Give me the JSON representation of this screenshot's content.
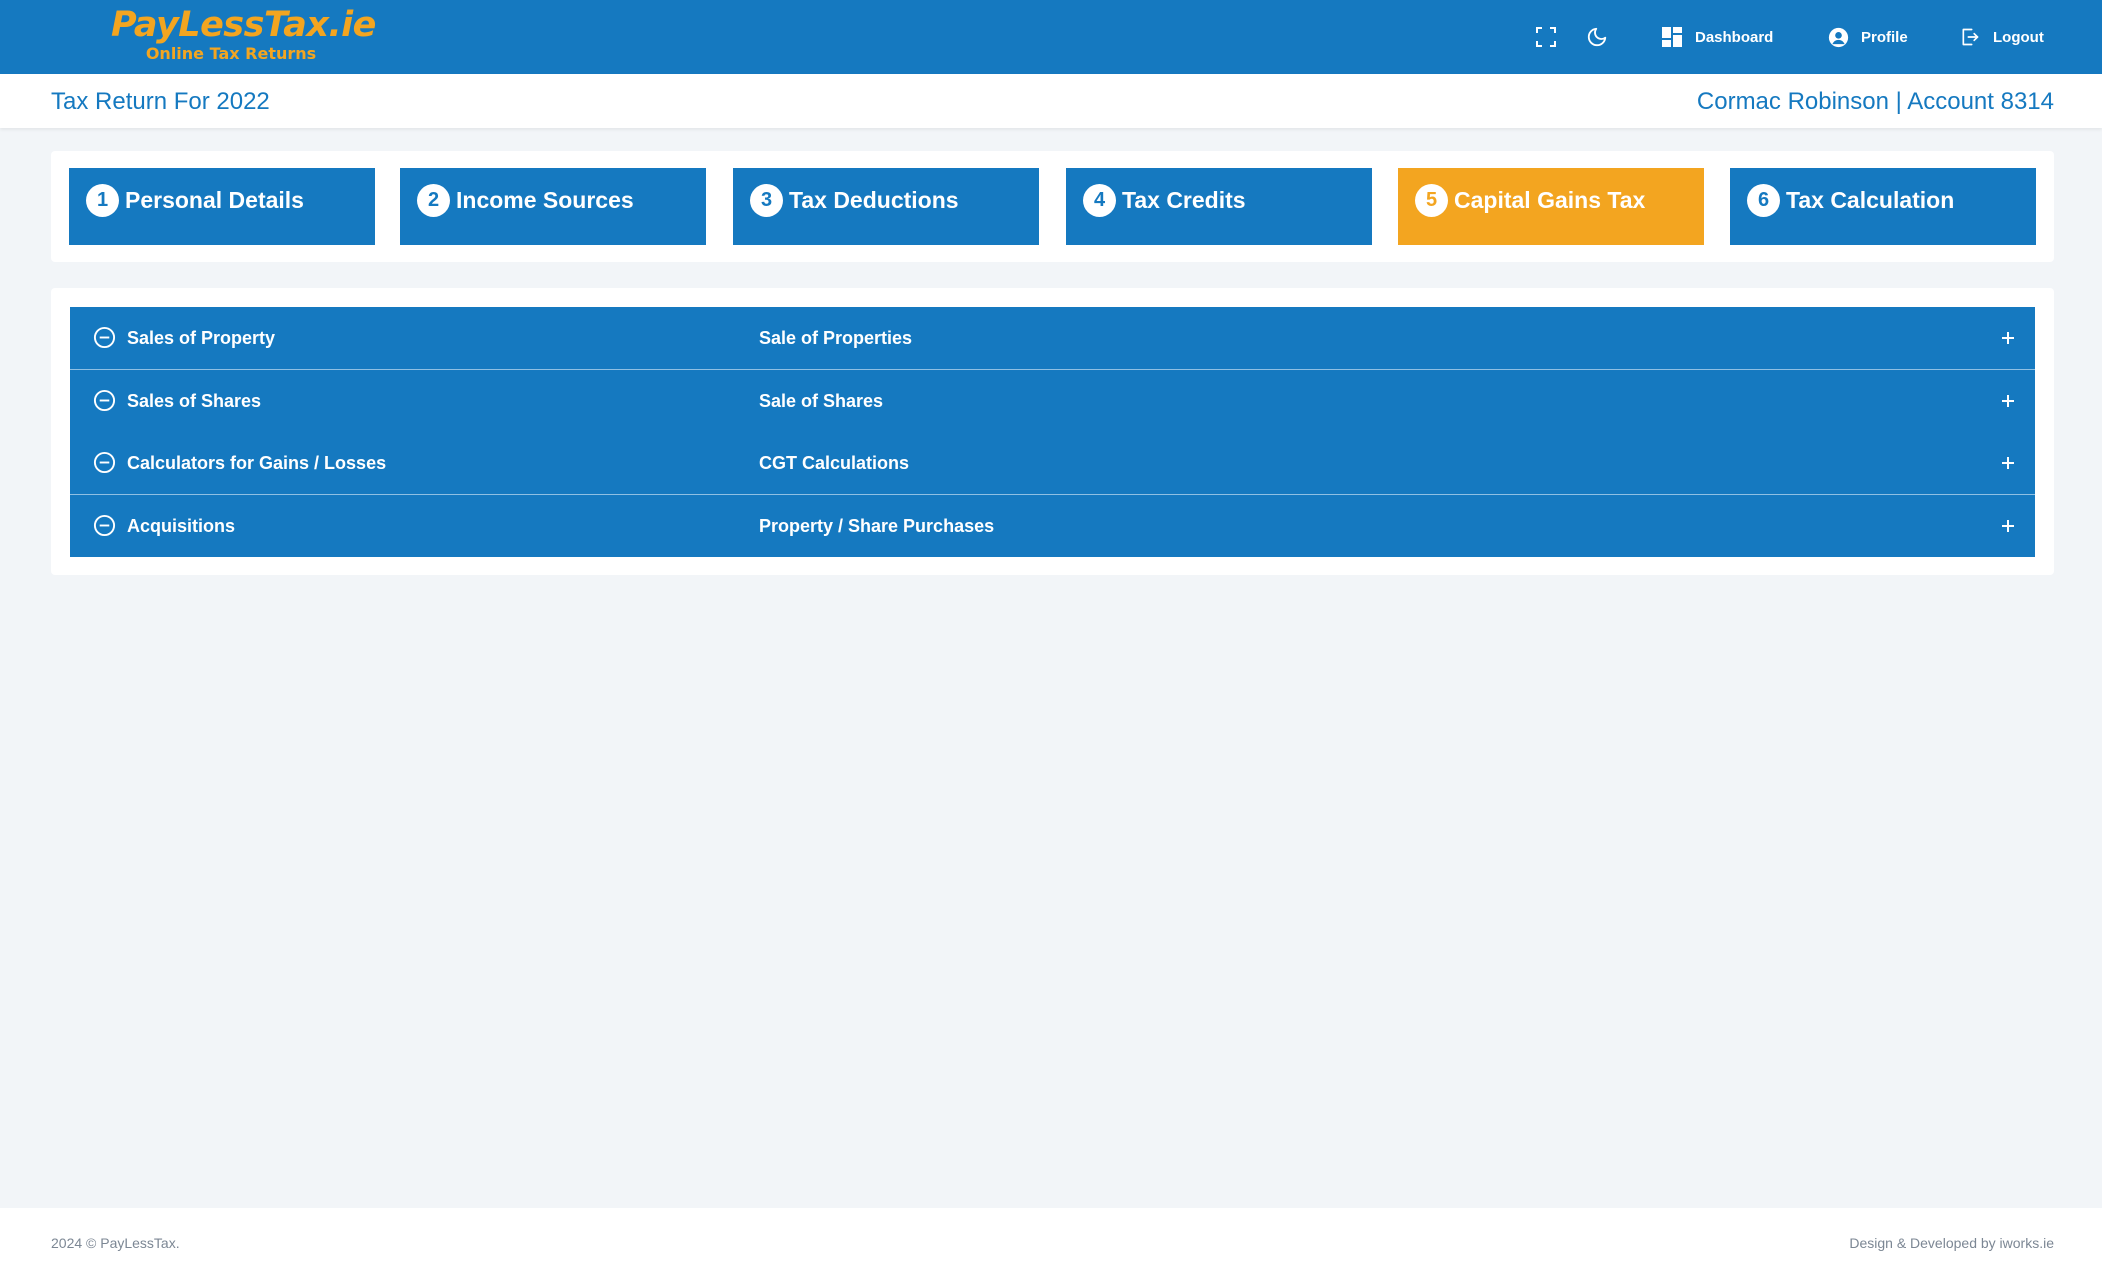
{
  "brand": {
    "name": "PayLessTax.ie",
    "tagline": "Online Tax Returns",
    "color": "#f3a520"
  },
  "header": {
    "icons": [
      "fullscreen-icon",
      "moon-icon"
    ],
    "nav": [
      {
        "label": "Dashboard",
        "icon": "dashboard-icon"
      },
      {
        "label": "Profile",
        "icon": "user-circle-icon"
      },
      {
        "label": "Logout",
        "icon": "logout-icon"
      }
    ]
  },
  "subheader": {
    "title": "Tax Return For 2022",
    "account": "Cormac Robinson | Account 8314"
  },
  "steps": [
    {
      "num": "1",
      "label": "Personal Details",
      "active": false
    },
    {
      "num": "2",
      "label": "Income Sources",
      "active": false
    },
    {
      "num": "3",
      "label": "Tax Deductions",
      "active": false
    },
    {
      "num": "4",
      "label": "Tax Credits",
      "active": false
    },
    {
      "num": "5",
      "label": "Capital Gains Tax",
      "active": true
    },
    {
      "num": "6",
      "label": "Tax Calculation",
      "active": false
    }
  ],
  "sections": [
    {
      "label": "Sales of Property",
      "description": "Sale of Properties"
    },
    {
      "label": "Sales of Shares",
      "description": "Sale of Shares"
    },
    {
      "label": "Calculators for Gains / Losses",
      "description": "CGT Calculations"
    },
    {
      "label": "Acquisitions",
      "description": "Property / Share Purchases"
    }
  ],
  "footer": {
    "copyright": "2024 © PayLessTax.",
    "credit": "Design & Developed by iworks.ie"
  },
  "colors": {
    "primary": "#1579c0",
    "accent": "#f3a520",
    "background": "#f2f5f8"
  }
}
